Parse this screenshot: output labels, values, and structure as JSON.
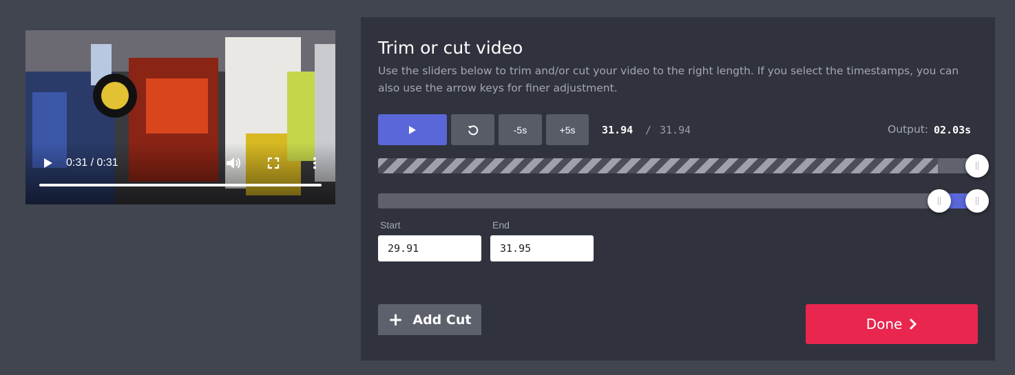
{
  "video_player": {
    "current_time": "0:31",
    "duration": "0:31",
    "time_display": "0:31 / 0:31",
    "progress_fraction": 1.0,
    "icons": [
      "play-icon",
      "volume-icon",
      "fullscreen-icon",
      "more-options-icon"
    ]
  },
  "editor": {
    "title": "Trim or cut video",
    "description": "Use the sliders below to trim and/or cut your video to the right length. If you select the timestamps, you can also use the arrow keys for finer adjustment.",
    "controls": {
      "play_icon": "play-icon",
      "reset_icon": "reset-icon",
      "minus_label": "-5s",
      "plus_label": "+5s"
    },
    "time": {
      "current": "31.94",
      "separator": "/",
      "total": "31.94"
    },
    "output": {
      "label": "Output:",
      "value": "02.03s"
    },
    "trim_slider": {
      "played_fraction": 0.934,
      "end_fraction": 1.0
    },
    "cut_slider": {
      "start_fraction": 0.937,
      "end_fraction": 1.0
    },
    "start": {
      "label": "Start",
      "value": "29.91"
    },
    "end": {
      "label": "End",
      "value": "31.95"
    },
    "add_cut_label": "Add Cut",
    "done_label": "Done"
  },
  "colors": {
    "accent": "#5a67d8",
    "done": "#e8264e",
    "panel": "#30333d",
    "background": "#414550"
  }
}
